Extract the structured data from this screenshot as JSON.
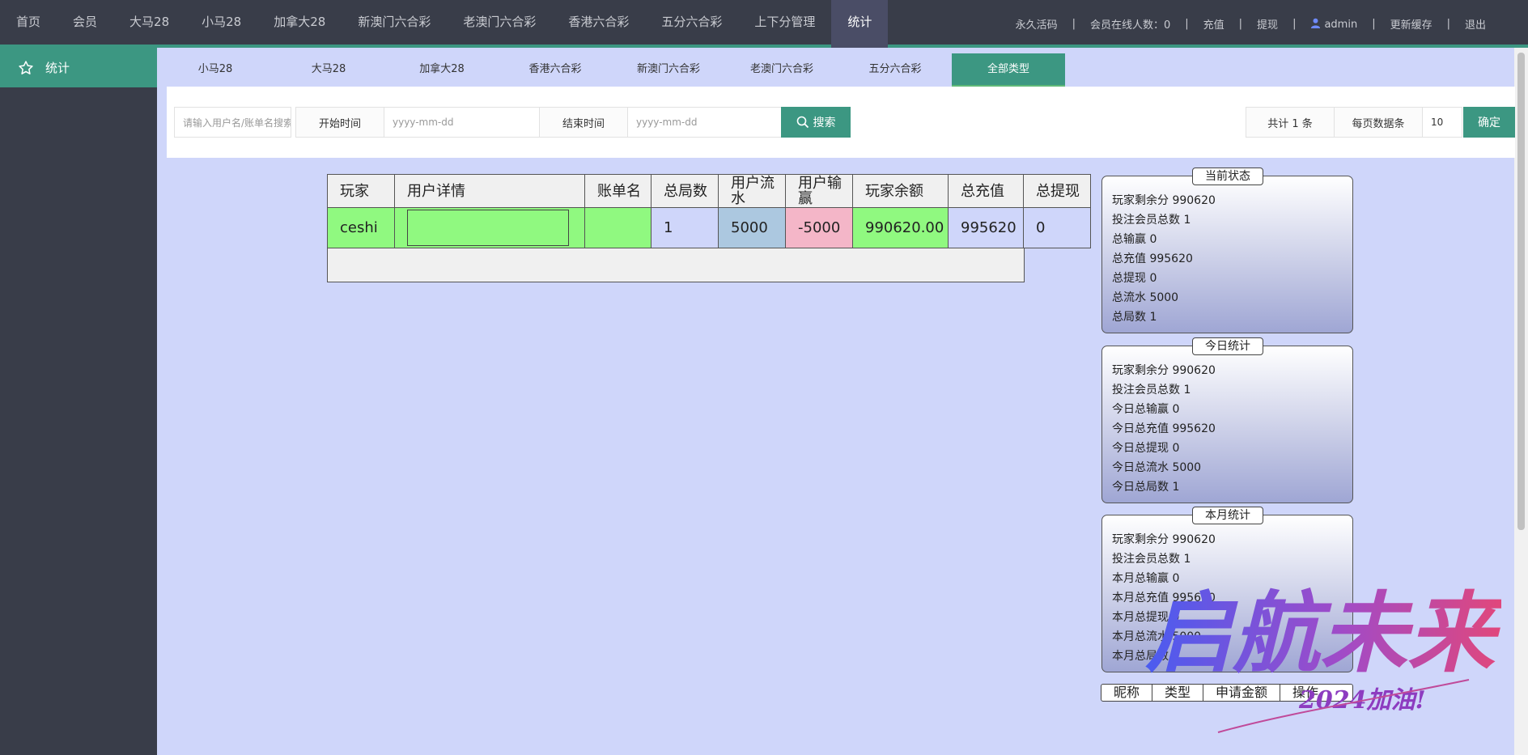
{
  "nav": {
    "items": [
      "首页",
      "会员",
      "大马28",
      "小马28",
      "加拿大28",
      "新澳门六合彩",
      "老澳门六合彩",
      "香港六合彩",
      "五分六合彩",
      "上下分管理",
      "统计"
    ],
    "active": "统计",
    "right": {
      "activation": "永久活码",
      "online": "会员在线人数：0",
      "recharge": "充值",
      "withdraw": "提现",
      "user": "admin",
      "refresh": "更新缓存",
      "logout": "退出"
    }
  },
  "sidebar": {
    "items": [
      {
        "label": "统计",
        "icon": "star-icon"
      }
    ]
  },
  "tabs": [
    "小马28",
    "大马28",
    "加拿大28",
    "香港六合彩",
    "新澳门六合彩",
    "老澳门六合彩",
    "五分六合彩",
    "全部类型"
  ],
  "active_tab": "全部类型",
  "search": {
    "placeholder": "请输入用户名/账单名搜索",
    "start_label": "开始时间",
    "start_placeholder": "yyyy-mm-dd",
    "end_label": "结束时间",
    "end_placeholder": "yyyy-mm-dd",
    "search_button": "搜索",
    "total": "共计 1 条",
    "per_page_label": "每页数据条",
    "per_page_value": "10",
    "confirm": "确定"
  },
  "table": {
    "headers": [
      "玩家",
      "用户详情",
      "账单名",
      "总局数",
      "用户流水",
      "用户输赢",
      "玩家余额",
      "总充值",
      "总提现"
    ],
    "rows": [
      {
        "player": "ceshi",
        "detail": "",
        "bill": "",
        "rounds": "1",
        "flow": "5000",
        "winloss": "-5000",
        "balance": "990620.00",
        "recharge": "995620",
        "withdraw": "0"
      }
    ]
  },
  "panels": {
    "current": {
      "title": "当前状态",
      "rows": [
        "玩家剩余分 990620",
        "投注会员总数 1",
        "总输赢 0",
        "总充值 995620",
        "总提现 0",
        "总流水 5000",
        "总局数 1"
      ]
    },
    "today": {
      "title": "今日统计",
      "rows": [
        "玩家剩余分 990620",
        "投注会员总数 1",
        "今日总输赢 0",
        "今日总充值 995620",
        "今日总提现 0",
        "今日总流水 5000",
        "今日总局数 1"
      ]
    },
    "month": {
      "title": "本月统计",
      "rows": [
        "玩家剩余分 990620",
        "投注会员总数 1",
        "本月总输赢 0",
        "本月总充值 995620",
        "本月总提现 0",
        "本月总流水 5000",
        "本月总局数 1"
      ]
    }
  },
  "apply_table": {
    "headers": [
      "昵称",
      "类型",
      "申请金额",
      "操作"
    ]
  },
  "watermark": {
    "main": "启航未来",
    "sub": "2024加油!"
  },
  "colors": {
    "accent": "#3c9782",
    "nav_bg": "#393d49",
    "page_bg": "#cfd6fa",
    "green": "#90f980",
    "blue": "#acc8e0",
    "pink": "#f4b6c8"
  }
}
